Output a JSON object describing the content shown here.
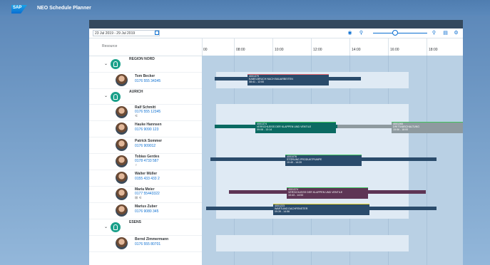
{
  "brand": {
    "logo": "SAP",
    "app_title": "NEO Schedule Planner"
  },
  "toolbar": {
    "date_range": "23 Jul 2019 - 29 Jul 2019",
    "icons": [
      "calendar-icon",
      "eye-icon",
      "zoom-out-icon",
      "zoom-in-icon",
      "legend-icon",
      "settings-icon"
    ]
  },
  "resource_header": "Resource",
  "timeline": {
    "ticks": [
      "00",
      "08:00",
      "10:00",
      "12:00",
      "14:00",
      "16:00",
      "18:00"
    ]
  },
  "groups": [
    {
      "name": "REGION NORD",
      "people": [
        {
          "name": "Tom Becker",
          "phone": "0176 555 34345",
          "extra": ""
        }
      ]
    },
    {
      "name": "AURICH",
      "people": [
        {
          "name": "Ralf Schmitt",
          "phone": "0176 555 12345",
          "extra": "⚟"
        },
        {
          "name": "Hauke Hannsen",
          "phone": "0176 9090 123",
          "extra": ""
        },
        {
          "name": "Patrick Sommer",
          "phone": "0176 909012",
          "extra": ""
        },
        {
          "name": "Tobias Gerdes",
          "phone": "0178 4733 587",
          "extra": "♀"
        },
        {
          "name": "Walter Müller",
          "phone": "0155 433 433 2",
          "extra": ""
        },
        {
          "name": "Maria Meier",
          "phone": "0177 55443322",
          "extra": "⊞ ⚟"
        },
        {
          "name": "Marius Zuber",
          "phone": "0176 9080 345",
          "extra": ""
        }
      ]
    },
    {
      "name": "ESENS",
      "people": [
        {
          "name": "Bernd Zimmermann",
          "phone": "0176 555 80701",
          "extra": ""
        }
      ]
    }
  ],
  "bars": [
    {
      "id": "4001379",
      "title": "KABELBRUCH NACH BAUARBEITEN",
      "time": "08:41 - 12:00",
      "color": "#2a4b6b",
      "top": "#e4676e"
    },
    {
      "id": "4001374",
      "title": "VERSCHLEISS DER KLAPPEN UND VENTILE",
      "time": "09:08 - 13:14",
      "color": "#0b6a62",
      "top": "#3fc55f"
    },
    {
      "id": "4001265",
      "title": "DRITTABSCHALTUNG",
      "time": "15:56 - 18:00",
      "color": "#8e9a9f",
      "top": "#3fc55f"
    },
    {
      "id": "4001076",
      "title": "STÖRUNG PRODUKTPUMPE",
      "time": "10:40 - 14:20",
      "color": "#2a4b6b",
      "top": "#3fc55f"
    },
    {
      "id": "4001374",
      "title": "VERSCHLEISS DER KLAPPEN UND VENTILE",
      "time": "10:43 - 14:53",
      "color": "#5e3555",
      "top": "#3fc55f"
    },
    {
      "id": "4001223",
      "title": "WARTUNG DACHFENSTER",
      "time": "09:39 - 14:56",
      "color": "#2a4b6b",
      "top": "#e8d12a"
    }
  ]
}
